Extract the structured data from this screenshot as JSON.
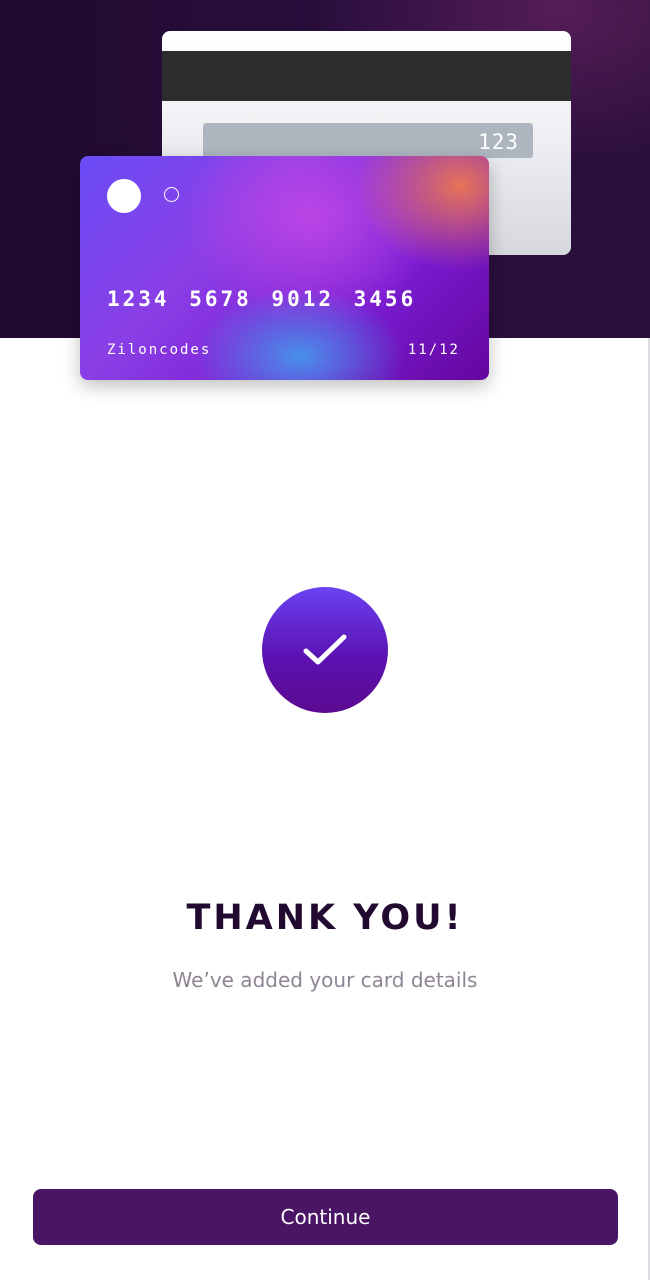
{
  "card_back": {
    "cvc": "123"
  },
  "card_front": {
    "number": "1234 5678 9012 3456",
    "holder": "Ziloncodes",
    "expiry": "11/12"
  },
  "confirmation": {
    "title": "THANK YOU!",
    "subtitle": "We’ve added your card details",
    "icon": "checkmark-icon"
  },
  "actions": {
    "continue_label": "Continue"
  },
  "colors": {
    "hero_background": "#240c35",
    "primary_button": "#4b1565",
    "title_text": "#21092f",
    "subtitle_text": "#8e8593"
  }
}
